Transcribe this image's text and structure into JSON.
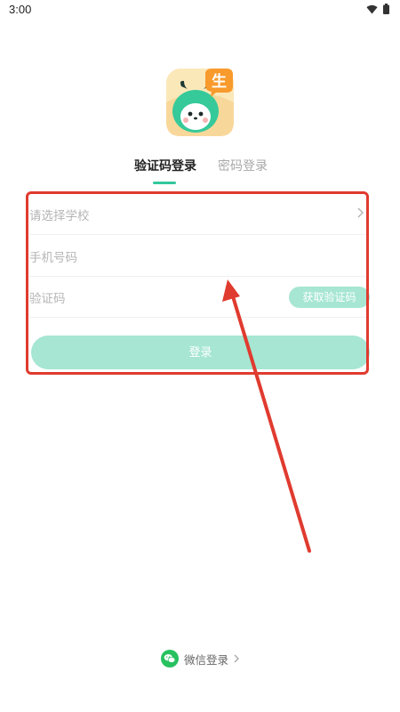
{
  "status_bar": {
    "time": "3:00",
    "icons": [
      "wifi-icon",
      "battery-icon"
    ]
  },
  "logo": {
    "badge_text": "生"
  },
  "tabs": [
    {
      "label": "验证码登录",
      "active": true
    },
    {
      "label": "密码登录",
      "active": false
    }
  ],
  "form": {
    "school_placeholder": "请选择学校",
    "phone_placeholder": "手机号码",
    "code_placeholder": "验证码",
    "get_code_label": "获取验证码",
    "login_label": "登录"
  },
  "wechat": {
    "label": "微信登录"
  },
  "colors": {
    "accent": "#34c79b",
    "button_disabled": "#a6e6d3",
    "annotation": "#e03b2f",
    "wechat": "#27c160"
  }
}
